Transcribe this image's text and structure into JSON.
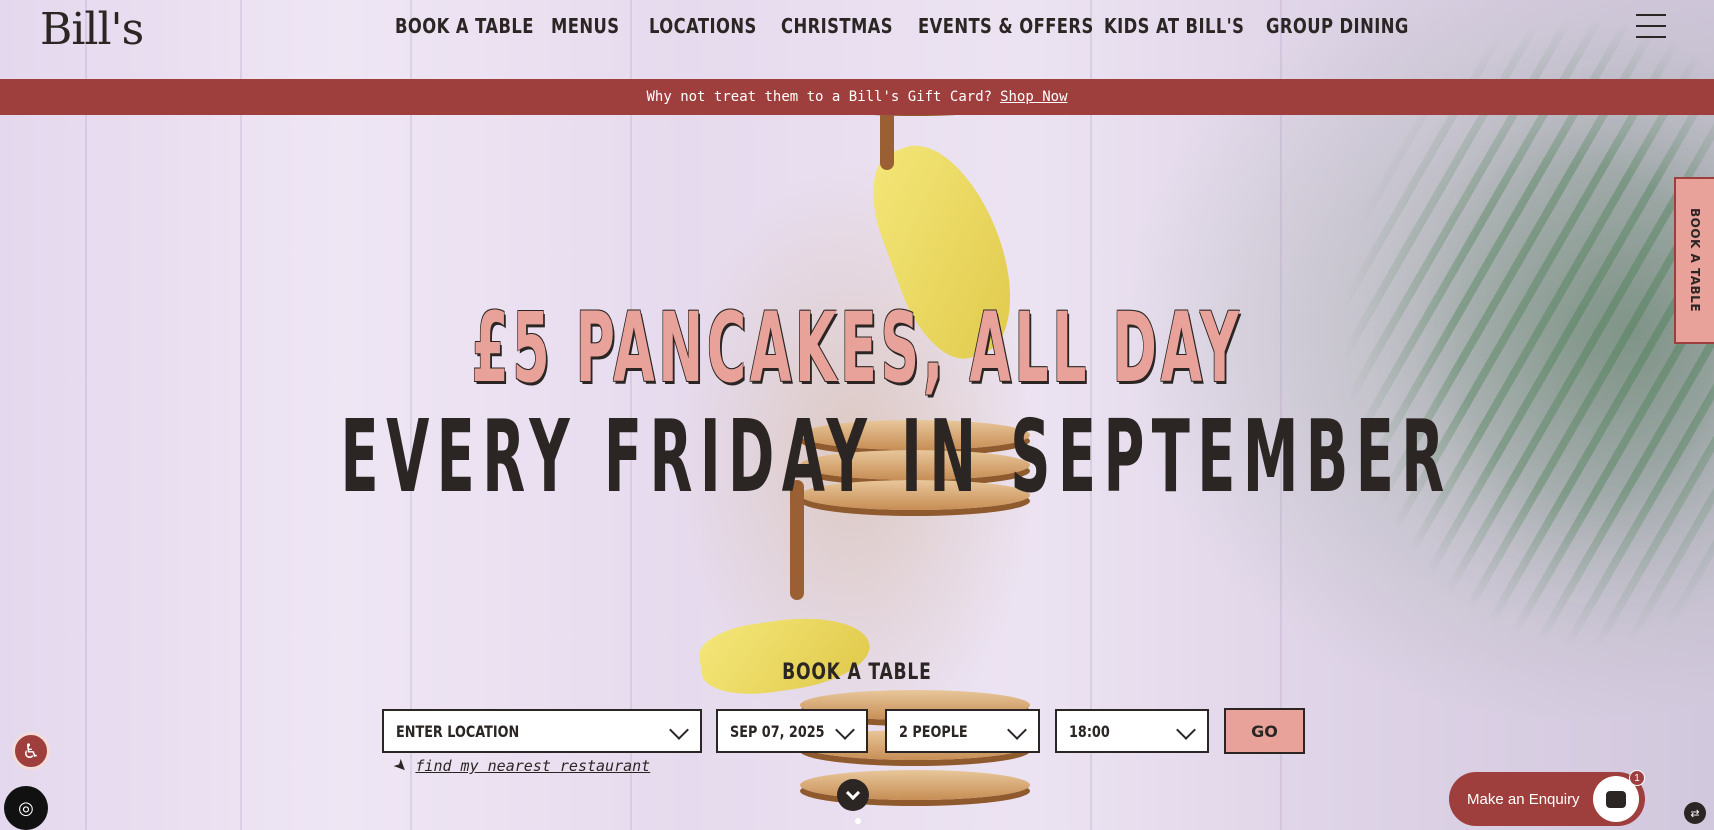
{
  "header": {
    "logo": "Bill's",
    "nav": [
      "BOOK A TABLE",
      "MENUS",
      "LOCATIONS",
      "CHRISTMAS",
      "EVENTS & OFFERS",
      "KIDS AT BILL'S",
      "GROUP DINING"
    ]
  },
  "promo": {
    "text": "Why not treat them to a Bill's Gift Card?",
    "link": "Shop Now"
  },
  "hero": {
    "line1": "£5 PANCAKES, ALL DAY",
    "line2": "EVERY FRIDAY IN SEPTEMBER"
  },
  "side_tab": "BOOK A TABLE",
  "booking": {
    "title": "BOOK A TABLE",
    "location": "ENTER LOCATION",
    "date": "SEP 07, 2025",
    "people": "2 PEOPLE",
    "time": "18:00",
    "go": "GO",
    "nearest": "find my nearest restaurant"
  },
  "widgets": {
    "enquiry": "Make an Enquiry",
    "badge_count": "1"
  },
  "colors": {
    "brand_red": "#9e3f3d",
    "pink": "#e8a29a",
    "dark": "#2b2624"
  }
}
